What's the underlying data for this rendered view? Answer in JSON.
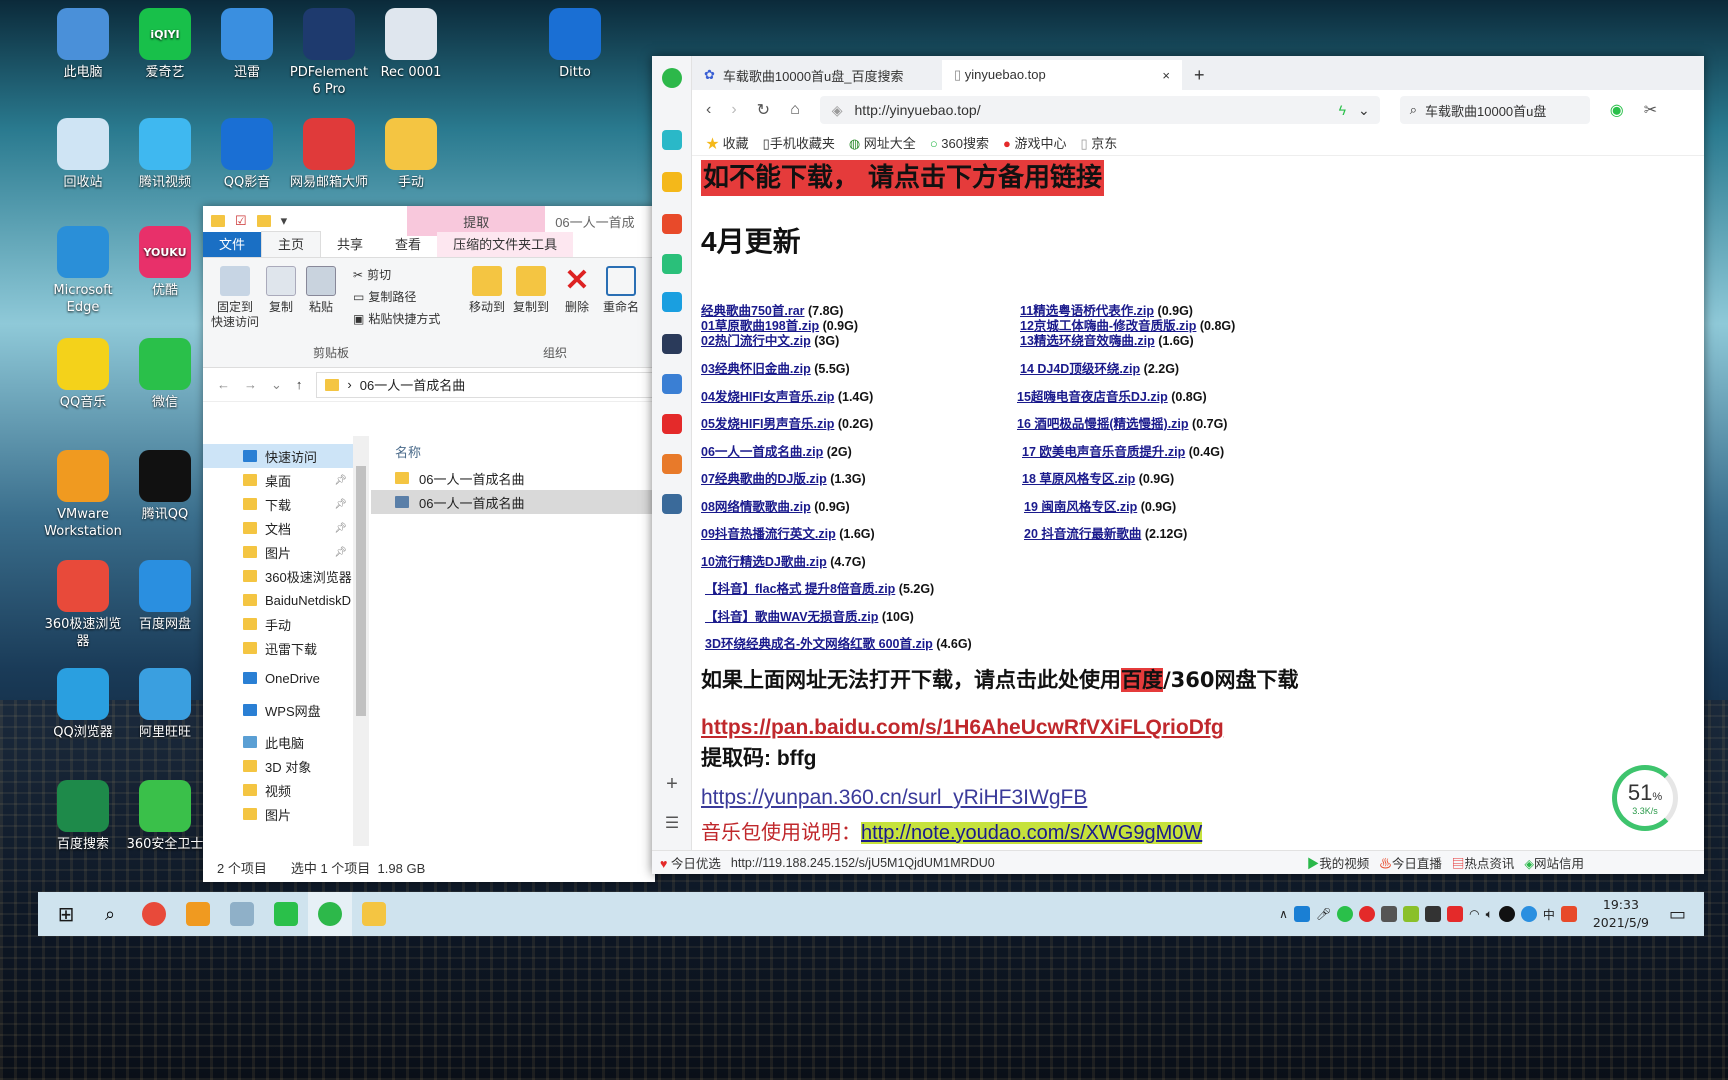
{
  "desktop": {
    "icons": [
      {
        "label": "此电脑",
        "color": "#4a90d9"
      },
      {
        "label": "爱奇艺",
        "color": "#18c04a",
        "glyph": "iQIYI"
      },
      {
        "label": "迅雷",
        "color": "#3a8fe0"
      },
      {
        "label": "PDFelement 6 Pro",
        "color": "#1e3a6e"
      },
      {
        "label": "Rec 0001",
        "color": "#dfe6ee"
      },
      {
        "label": "Ditto",
        "color": "#1a6fd4"
      },
      {
        "label": "回收站",
        "color": "#cfe4f4"
      },
      {
        "label": "腾讯视频",
        "color": "#3fb8f0"
      },
      {
        "label": "QQ影音",
        "color": "#1a6fd4"
      },
      {
        "label": "网易邮箱大师",
        "color": "#e03a3a"
      },
      {
        "label": "手动",
        "color": "#f4c542"
      },
      {
        "label": "Microsoft Edge",
        "color": "#2a8fd8"
      },
      {
        "label": "优酷",
        "color": "#e8306a",
        "glyph": "YOUKU"
      },
      {
        "label": "QQ音乐",
        "color": "#f4d21a"
      },
      {
        "label": "微信",
        "color": "#2ac04a"
      },
      {
        "label": "VMware Workstation",
        "color": "#f09a20"
      },
      {
        "label": "腾讯QQ",
        "color": "#111"
      },
      {
        "label": "360极速浏览器",
        "color": "#e84a3a"
      },
      {
        "label": "百度网盘",
        "color": "#2a8fe0"
      },
      {
        "label": "QQ浏览器",
        "color": "#2a9fe0"
      },
      {
        "label": "阿里旺旺",
        "color": "#3a9fe0"
      },
      {
        "label": "百度搜索",
        "color": "#1e8a4a"
      },
      {
        "label": "360安全卫士",
        "color": "#3ac04a"
      }
    ]
  },
  "explorer": {
    "ctx_header": "提取",
    "title_text": "06一人一首成",
    "tabs": {
      "file": "文件",
      "home": "主页",
      "share": "共享",
      "view": "查看",
      "ctx": "压缩的文件夹工具"
    },
    "ribbon": {
      "pin": "固定到\n快速访问",
      "copy": "复制",
      "paste": "粘贴",
      "cut": "剪切",
      "copy_path": "复制路径",
      "paste_shortcut": "粘贴快捷方式",
      "move_to": "移动到",
      "copy_to": "复制到",
      "delete": "删除",
      "rename": "重命名",
      "group_clipboard": "剪贴板",
      "group_organize": "组织"
    },
    "path": "06一人一首成名曲",
    "nav": [
      {
        "label": "快速访问",
        "pin": false,
        "sel": true
      },
      {
        "label": "桌面",
        "pin": true
      },
      {
        "label": "下载",
        "pin": true
      },
      {
        "label": "文档",
        "pin": true
      },
      {
        "label": "图片",
        "pin": true
      },
      {
        "label": "360极速浏览器"
      },
      {
        "label": "BaiduNetdiskD"
      },
      {
        "label": "手动"
      },
      {
        "label": "迅雷下载"
      },
      {
        "label": "OneDrive"
      },
      {
        "label": "WPS网盘"
      },
      {
        "label": "此电脑"
      },
      {
        "label": "3D 对象"
      },
      {
        "label": "视频"
      },
      {
        "label": "图片"
      }
    ],
    "column_name": "名称",
    "files": [
      "06一人一首成名曲",
      "06一人一首成名曲"
    ],
    "status": {
      "count": "2 个项目",
      "selected": "选中 1 个项目",
      "size": "1.98 GB"
    }
  },
  "browser": {
    "tabs": [
      {
        "label": "车载歌曲10000首u盘_百度搜索"
      },
      {
        "label": "yinyuebao.top"
      }
    ],
    "url": "http://yinyuebao.top/",
    "search_text": "车载歌曲10000首u盘",
    "bookmarks": [
      "收藏",
      "手机收藏夹",
      "网址大全",
      "360搜索",
      "游戏中心",
      "京东"
    ],
    "page": {
      "banner": "如不能下载， 请点击下方备用链接",
      "heading": "4月更新",
      "left_links": [
        {
          "name": "经典歌曲750首.rar",
          "size": "(7.8G)"
        },
        {
          "name": "01草原歌曲198首.zip",
          "size": "(0.9G)"
        },
        {
          "name": "02热门流行中文.zip",
          "size": "(3G)"
        },
        {
          "name": "03经典怀旧金曲.zip",
          "size": "(5.5G)"
        },
        {
          "name": "04发烧HIFI女声音乐.zip",
          "size": "(1.4G)"
        },
        {
          "name": "05发烧HIFI男声音乐.zip",
          "size": "(0.2G)"
        },
        {
          "name": "06一人一首成名曲.zip",
          "size": "(2G)"
        },
        {
          "name": "07经典歌曲的DJ版.zip",
          "size": "(1.3G)"
        },
        {
          "name": "08网络情歌歌曲.zip",
          "size": "(0.9G)"
        },
        {
          "name": "09抖音热播流行英文.zip",
          "size": "(1.6G)"
        },
        {
          "name": "10流行精选DJ歌曲.zip",
          "size": "(4.7G)"
        },
        {
          "name": "【抖音】flac格式 提升8倍音质.zip",
          "size": "(5.2G)"
        },
        {
          "name": "【抖音】歌曲WAV无损音质.zip",
          "size": "(10G)"
        },
        {
          "name": "3D环绕经典成名-外文网络红歌 600首.zip",
          "size": "(4.6G)"
        }
      ],
      "right_links": [
        {
          "name": "11精选粤语桥代表作.zip",
          "size": "(0.9G)"
        },
        {
          "name": "12京城工体嗨曲-修改音质版.zip",
          "size": "(0.8G)"
        },
        {
          "name": "13精选环绕音效嗨曲.zip",
          "size": "(1.6G)"
        },
        {
          "name": "14 DJ4D顶级环绕.zip",
          "size": "(2.2G)"
        },
        {
          "name": "15超嗨电音夜店音乐DJ.zip",
          "size": "(0.8G)"
        },
        {
          "name": "16 酒吧极品慢摇(精选慢摇).zip",
          "size": "(0.7G)"
        },
        {
          "name": "17 欧美电声音乐音质提升.zip",
          "size": "(0.4G)"
        },
        {
          "name": "18 草原风格专区.zip",
          "size": "(0.9G)"
        },
        {
          "name": "19 闽南风格专区.zip",
          "size": "(0.9G)"
        },
        {
          "name": "20 抖音流行最新歌曲",
          "size": "(2.12G)"
        }
      ],
      "notice_pre": "如果上面网址无法打开下载，请点击此处使用",
      "notice_hl": "百度",
      "notice_post": "/360网盘下载",
      "baidu_url": "https://pan.baidu.com/s/1H6AheUcwRfVXiFLQrioDfg",
      "code_label": "提取码: bffg",
      "yunpan_url": "https://yunpan.360.cn/surl_yRiHF3IWgFB",
      "usage_label": "音乐包使用说明：",
      "usage_url": "http://note.youdao.com/s/XWG9gM0W"
    },
    "status": {
      "left": "今日优选",
      "link": "http://119.188.245.152/s/jU5M1QjdUM1MRDU0",
      "items": [
        "我的视频",
        "今日直播",
        "热点资讯",
        "网站信用"
      ]
    }
  },
  "speed_widget": {
    "percent": "51",
    "unit": "%",
    "rate": "3.3K/s"
  },
  "taskbar": {
    "time": "19:33",
    "date": "2021/5/9",
    "ime": "中"
  }
}
